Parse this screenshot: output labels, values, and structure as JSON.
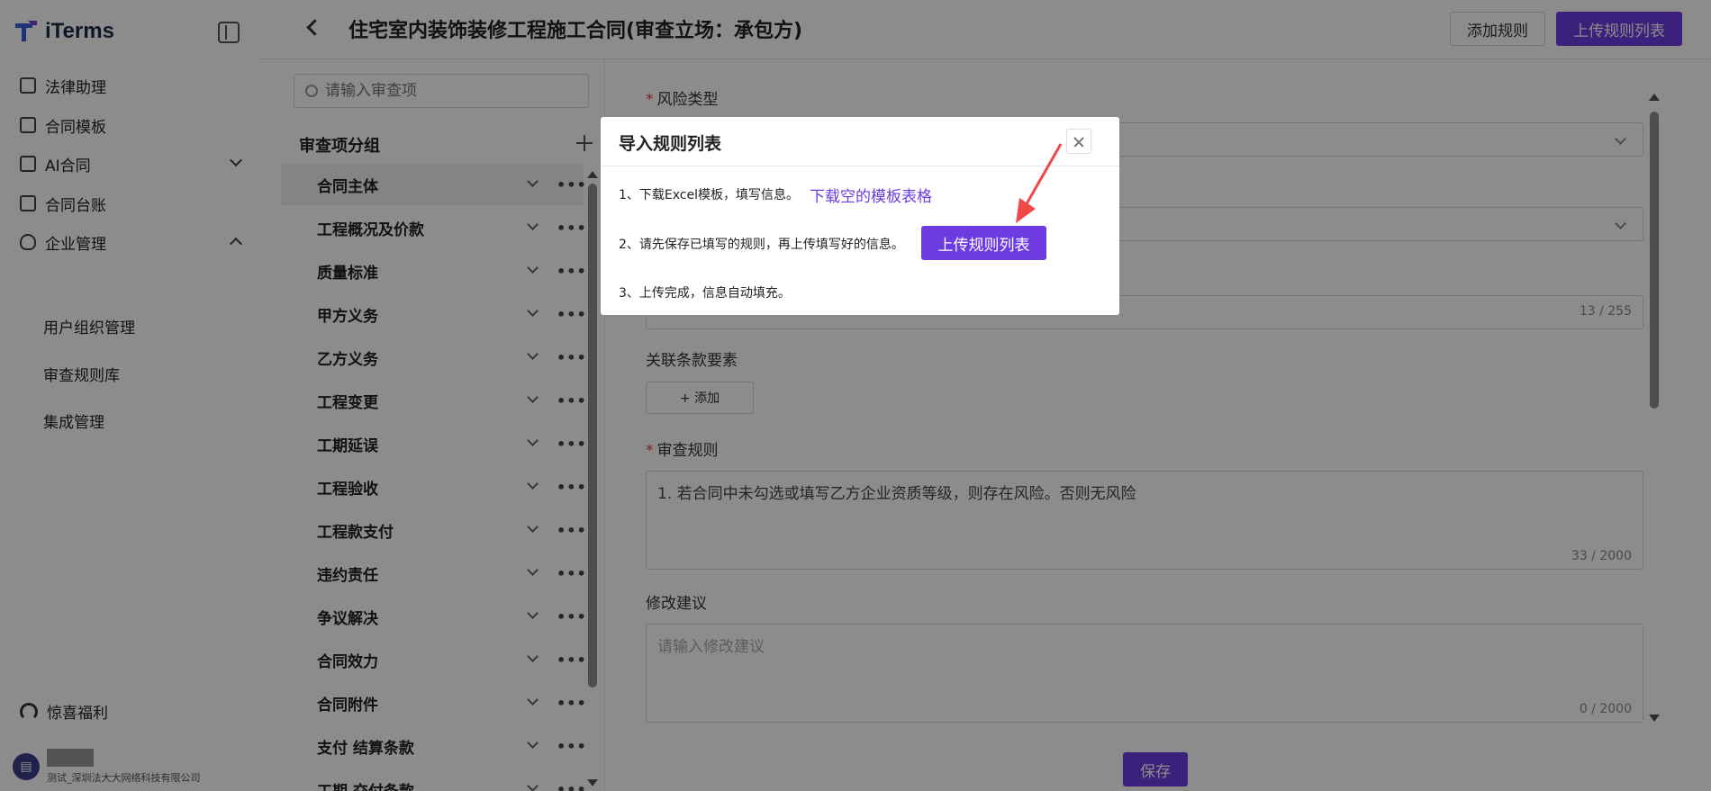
{
  "app": {
    "name": "iTerms"
  },
  "sidebar": {
    "items": [
      {
        "label": "法律助理"
      },
      {
        "label": "合同模板"
      },
      {
        "label": "AI合同"
      },
      {
        "label": "合同台账"
      },
      {
        "label": "企业管理"
      }
    ],
    "sub_items": [
      {
        "label": "用户组织管理"
      },
      {
        "label": "审查规则库"
      },
      {
        "label": "集成管理"
      }
    ],
    "bottom": {
      "label": "惊喜福利"
    },
    "user": {
      "org": "测试_深圳法大大网络科技有限公司"
    }
  },
  "header": {
    "title": "住宅室内装饰装修工程施工合同(审查立场：承包方)",
    "add_rule": "添加规则",
    "upload_rules": "上传规则列表"
  },
  "mid": {
    "search_placeholder": "请输入审查项",
    "group_title": "审查项分组",
    "groups": [
      {
        "label": "合同主体"
      },
      {
        "label": "工程概况及价款"
      },
      {
        "label": "质量标准"
      },
      {
        "label": "甲方义务"
      },
      {
        "label": "乙方义务"
      },
      {
        "label": "工程变更"
      },
      {
        "label": "工期延误"
      },
      {
        "label": "工程验收"
      },
      {
        "label": "工程款支付"
      },
      {
        "label": "违约责任"
      },
      {
        "label": "争议解决"
      },
      {
        "label": "合同效力"
      },
      {
        "label": "合同附件"
      },
      {
        "label": "支付 结算条款"
      },
      {
        "label": "工期 交付条款"
      }
    ],
    "more": "•••"
  },
  "form": {
    "risk_type_label": "风险类型",
    "name_counter": "13 / 255",
    "clause_label": "关联条款要素",
    "add_label": "+ 添加",
    "rule_label": "审查规则",
    "rule_value": "1. 若合同中未勾选或填写乙方企业资质等级，则存在风险。否则无风险",
    "rule_counter": "33 / 2000",
    "suggest_label": "修改建议",
    "suggest_placeholder": "请输入修改建议",
    "suggest_counter": "0 / 2000",
    "save": "保存"
  },
  "modal": {
    "title": "导入规则列表",
    "step1": "1、下载Excel模板，填写信息。",
    "step1_link": "下载空的模板表格",
    "step2": "2、请先保存已填写的规则，再上传填写好的信息。",
    "step2_button": "上传规则列表",
    "step3": "3、上传完成，信息自动填充。"
  },
  "colors": {
    "accent": "#6c3ce1",
    "required": "#e53935",
    "arrow": "#f04848"
  }
}
